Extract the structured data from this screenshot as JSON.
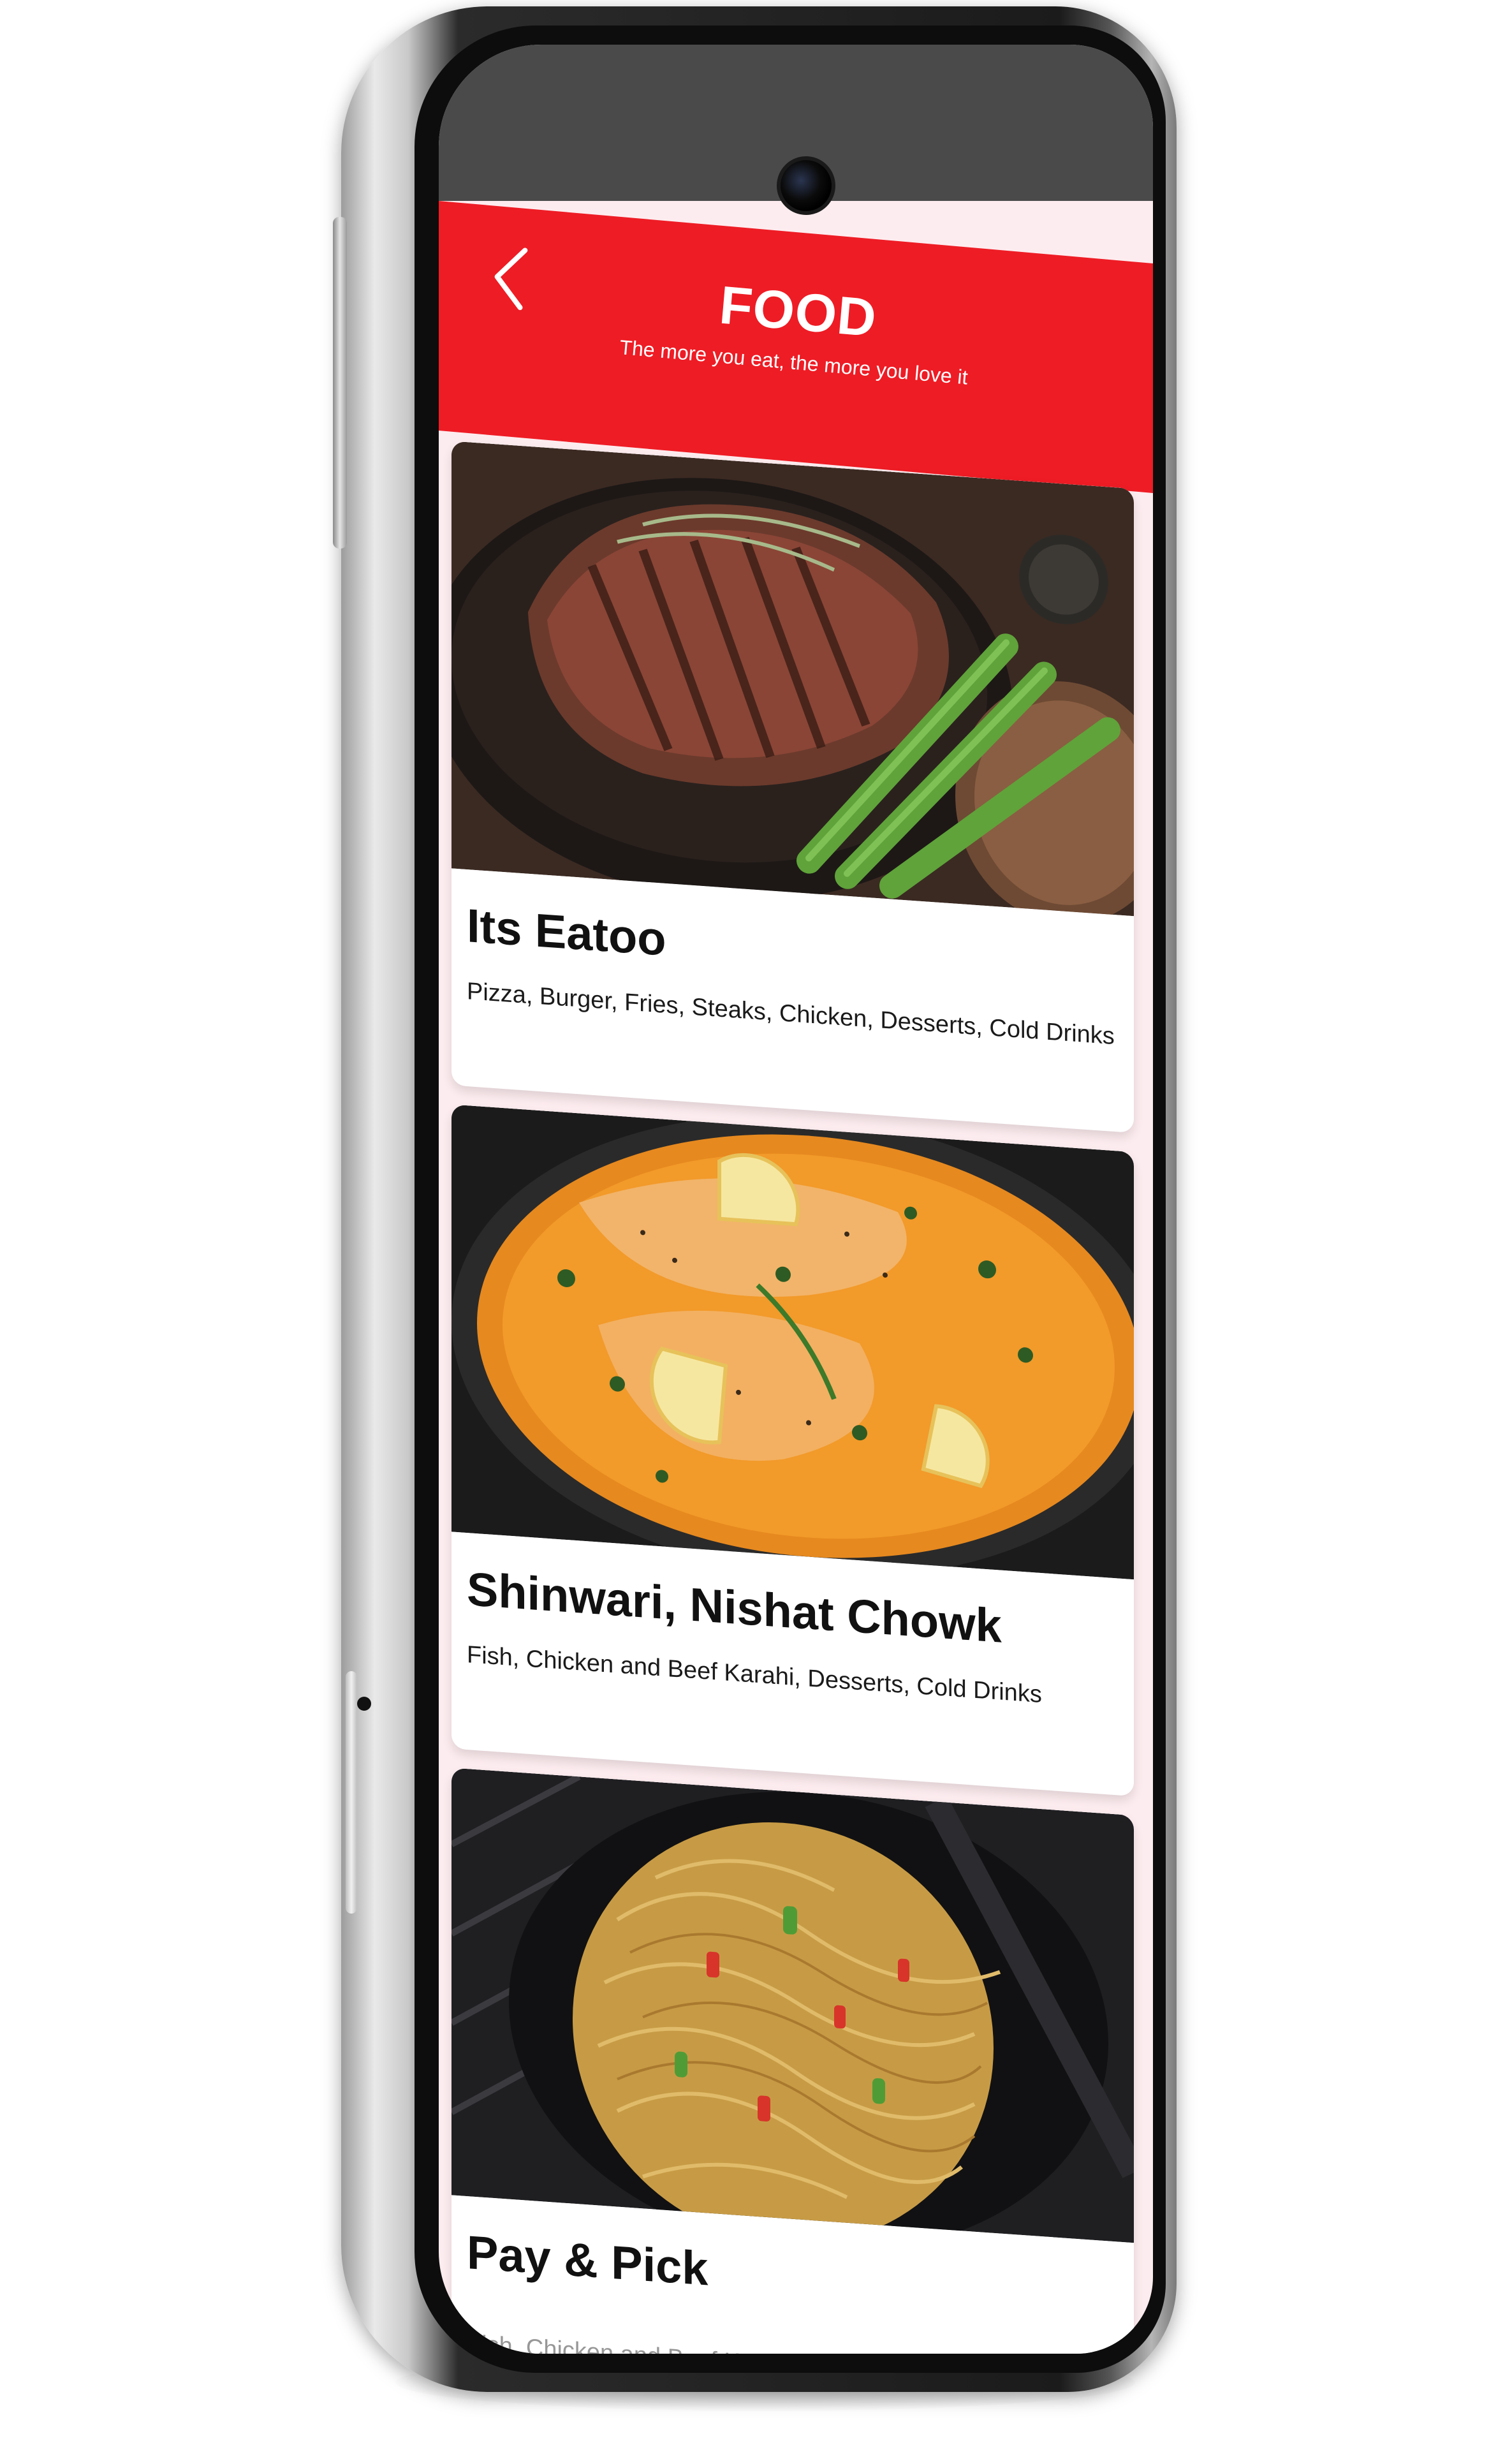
{
  "header": {
    "title": "FOOD",
    "subtitle": "The more you eat, the more you love it"
  },
  "restaurants": [
    {
      "name": "Its Eatoo",
      "description": "Pizza, Burger, Fries, Steaks, Chicken, Desserts, Cold Drinks",
      "image": "grilled-steak-with-asparagus"
    },
    {
      "name": "Shinwari, Nishat Chowk",
      "description": "Fish, Chicken and Beef Karahi, Desserts, Cold Drinks",
      "image": "fish-in-orange-curry-with-lemon"
    },
    {
      "name": "Pay & Pick",
      "description": "Fish, Chicken and Beef Karahi, Desserts, Cold Drinks",
      "image": "noodles-with-vegetables"
    }
  ],
  "colors": {
    "brand_red": "#ee1c25",
    "list_background": "#fdecef",
    "card_background": "#ffffff"
  },
  "icons": {
    "back": "chevron-left-icon"
  }
}
